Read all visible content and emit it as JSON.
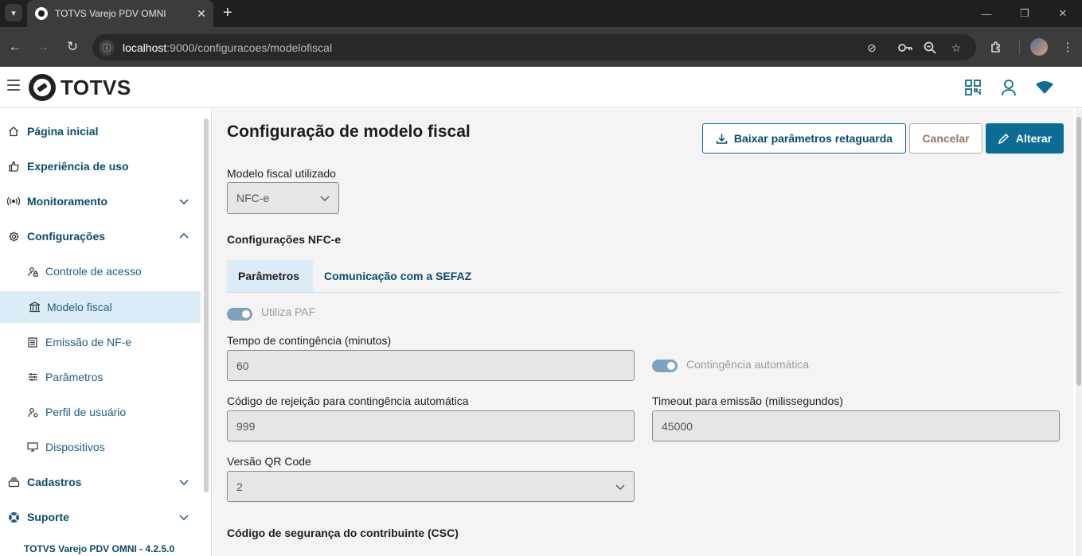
{
  "browser": {
    "tab_title": "TOTVS Varejo PDV OMNI",
    "url_host": "localhost",
    "url_rest": ":9000/configuracoes/modelofiscal"
  },
  "app": {
    "logo_text": "TOTVS",
    "version": "TOTVS Varejo PDV OMNI - 4.2.5.0"
  },
  "sidebar": {
    "items": [
      {
        "label": "Página inicial",
        "icon": "home-icon"
      },
      {
        "label": "Experiência de uso",
        "icon": "thumb-up-icon"
      },
      {
        "label": "Monitoramento",
        "icon": "broadcast-icon"
      },
      {
        "label": "Configurações",
        "icon": "gear-icon"
      },
      {
        "label": "Controle de acesso",
        "icon": "user-lock-icon"
      },
      {
        "label": "Modelo fiscal",
        "icon": "bank-icon"
      },
      {
        "label": "Emissão de NF-e",
        "icon": "document-icon"
      },
      {
        "label": "Parâmetros",
        "icon": "sliders-icon"
      },
      {
        "label": "Perfil de usuário",
        "icon": "user-settings-icon"
      },
      {
        "label": "Dispositivos",
        "icon": "monitor-icon"
      },
      {
        "label": "Cadastros",
        "icon": "stack-icon"
      },
      {
        "label": "Suporte",
        "icon": "lifebuoy-icon"
      }
    ]
  },
  "page": {
    "title": "Configuração de modelo fiscal",
    "buttons": {
      "download": "Baixar parâmetros retaguarda",
      "cancel": "Cancelar",
      "edit": "Alterar"
    },
    "modelo_label": "Modelo fiscal utilizado",
    "modelo_value": "NFC-e",
    "section_nfce": "Configurações NFC-e",
    "tabs": [
      "Parâmetros",
      "Comunicação com a SEFAZ"
    ],
    "utiliza_paf": "Utiliza PAF",
    "tempo_label": "Tempo de contingência (minutos)",
    "tempo_value": "60",
    "contingencia_auto": "Contingência automática",
    "rejeicao_label": "Código de rejeição para contingência automática",
    "rejeicao_value": "999",
    "timeout_label": "Timeout para emissão (milissegundos)",
    "timeout_value": "45000",
    "qr_label": "Versão QR Code",
    "qr_value": "2",
    "section_csc": "Código de segurança do contribuinte (CSC)"
  },
  "colors": {
    "primary": "#0c6c94",
    "nav_text": "#0c4a6e",
    "active_bg": "#dcecf7",
    "toggle": "#7ba3bf"
  }
}
